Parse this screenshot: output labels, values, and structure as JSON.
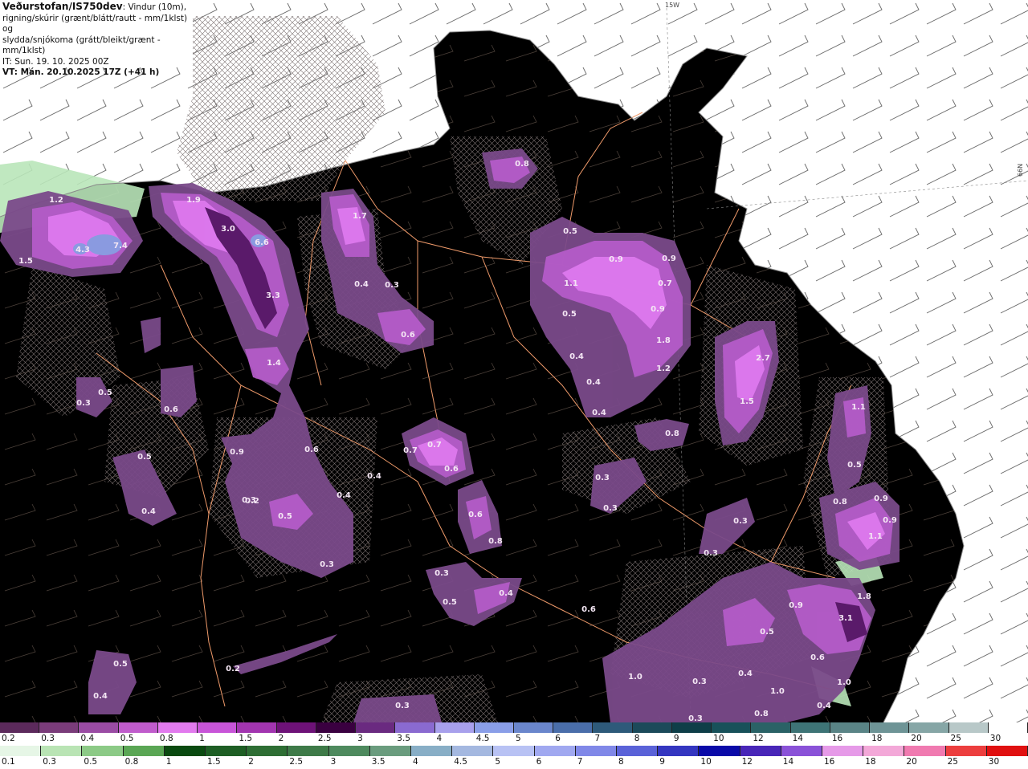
{
  "header": {
    "title_strong": "Veðurstofan/IS750dev",
    "title_rest": ": Vindur (10m),",
    "line2": "rigning/skúrir (grænt/blátt/rautt - mm/1klst) og",
    "line3": "slydda/snjókoma (grátt/bleikt/grænt - mm/1klst)",
    "it_line": "IT: Sun. 19. 10. 2025 00Z",
    "vt_line": "VT: Mán. 20.10.2025 17Z (+41 h)"
  },
  "grid_labels": {
    "lon": "15W",
    "lat": "66N"
  },
  "colors": {
    "sea": "#ffffff",
    "land": "#f1e2d0",
    "roads": "#ef9a6a",
    "coast": "#9a9a9a",
    "precip_light": "#7a4a8a",
    "precip_mid": "#b45cc8",
    "precip_high": "#e07af0",
    "precip_peak": "#5a1a6a",
    "precip_blue": "#8a9ae0",
    "rain_green": "#b9e6b9"
  },
  "map_labels": [
    {
      "text": "1.2"
    },
    {
      "text": "4.3"
    },
    {
      "text": "7.4"
    },
    {
      "text": "1.5"
    },
    {
      "text": "1.9"
    },
    {
      "text": "3.0"
    },
    {
      "text": "6.6"
    },
    {
      "text": "3.3"
    },
    {
      "text": "1.4"
    },
    {
      "text": "1.7"
    },
    {
      "text": "0.4"
    },
    {
      "text": "0.3"
    },
    {
      "text": "0.6"
    },
    {
      "text": "0.8"
    },
    {
      "text": "0.5"
    },
    {
      "text": "0.9"
    },
    {
      "text": "0.9"
    },
    {
      "text": "1.1"
    },
    {
      "text": "0.7"
    },
    {
      "text": "0.5"
    },
    {
      "text": "0.9"
    },
    {
      "text": "1.8"
    },
    {
      "text": "1.2"
    },
    {
      "text": "0.4"
    },
    {
      "text": "0.4"
    },
    {
      "text": "0.4"
    },
    {
      "text": "2.7"
    },
    {
      "text": "1.5"
    },
    {
      "text": "1.1"
    },
    {
      "text": "0.8"
    },
    {
      "text": "0.5"
    },
    {
      "text": "0.8"
    },
    {
      "text": "0.7"
    },
    {
      "text": "0.7"
    },
    {
      "text": "0.6"
    },
    {
      "text": "0.6"
    },
    {
      "text": "0.8"
    },
    {
      "text": "0.9"
    },
    {
      "text": "0.6"
    },
    {
      "text": "0.4"
    },
    {
      "text": "0.6"
    },
    {
      "text": "0.4"
    },
    {
      "text": "0.3"
    },
    {
      "text": "0.3"
    },
    {
      "text": "0.3"
    },
    {
      "text": "0.3"
    },
    {
      "text": "0.5"
    },
    {
      "text": "0.9"
    },
    {
      "text": "0.9"
    },
    {
      "text": "1.1"
    },
    {
      "text": "0.3"
    },
    {
      "text": "0.5"
    },
    {
      "text": "0.4"
    },
    {
      "text": "0.2"
    },
    {
      "text": "0.5"
    },
    {
      "text": "0.4"
    },
    {
      "text": "0.3"
    },
    {
      "text": "0.3"
    },
    {
      "text": "0.4"
    },
    {
      "text": "0.9"
    },
    {
      "text": "0.5"
    },
    {
      "text": "3.1"
    },
    {
      "text": "1.8"
    },
    {
      "text": "0.6"
    },
    {
      "text": "1.0"
    },
    {
      "text": "0.3"
    },
    {
      "text": "0.4"
    },
    {
      "text": "1.0"
    },
    {
      "text": "1.0"
    },
    {
      "text": "0.8"
    },
    {
      "text": "0.3"
    },
    {
      "text": "0.4"
    },
    {
      "text": "0.5"
    },
    {
      "text": "0.3"
    },
    {
      "text": "0.3"
    },
    {
      "text": "0.6"
    },
    {
      "text": "0.2"
    },
    {
      "text": "0.5"
    }
  ],
  "legend_snow": [
    {
      "label": "0.2",
      "color": "#5c2a5c"
    },
    {
      "label": "0.3",
      "color": "#7a3c7a"
    },
    {
      "label": "0.4",
      "color": "#9a4ca4"
    },
    {
      "label": "0.5",
      "color": "#c05ccc"
    },
    {
      "label": "0.8",
      "color": "#e27aee"
    },
    {
      "label": "1",
      "color": "#c855d8"
    },
    {
      "label": "1.5",
      "color": "#a235b0"
    },
    {
      "label": "2",
      "color": "#6e1278"
    },
    {
      "label": "2.5",
      "color": "#3a0040"
    },
    {
      "label": "3",
      "color": "#6a2a80"
    },
    {
      "label": "3.5",
      "color": "#8a6ad0"
    },
    {
      "label": "4",
      "color": "#a8a0ec"
    },
    {
      "label": "4.5",
      "color": "#8a9ee8"
    },
    {
      "label": "5",
      "color": "#6a86cc"
    },
    {
      "label": "6",
      "color": "#4a6eaa"
    },
    {
      "label": "7",
      "color": "#2e5a7a"
    },
    {
      "label": "8",
      "color": "#1c4a5a"
    },
    {
      "label": "9",
      "color": "#0e3e48"
    },
    {
      "label": "10",
      "color": "#18515a"
    },
    {
      "label": "12",
      "color": "#2a6266"
    },
    {
      "label": "14",
      "color": "#3e7476"
    },
    {
      "label": "16",
      "color": "#5a8486"
    },
    {
      "label": "18",
      "color": "#6e9496"
    },
    {
      "label": "20",
      "color": "#86a6a6"
    },
    {
      "label": "25",
      "color": "#b8c8c8"
    },
    {
      "label": "30",
      "color": "#ffffff"
    }
  ],
  "legend_rain": [
    {
      "label": "0.1",
      "color": "#e6f6e6"
    },
    {
      "label": "0.3",
      "color": "#b9e4b4"
    },
    {
      "label": "0.5",
      "color": "#8cca86"
    },
    {
      "label": "0.8",
      "color": "#5aa654"
    },
    {
      "label": "1",
      "color": "#0a4a10"
    },
    {
      "label": "1.5",
      "color": "#1e5e24"
    },
    {
      "label": "2",
      "color": "#2e6e34"
    },
    {
      "label": "2.5",
      "color": "#3e7a48"
    },
    {
      "label": "3",
      "color": "#4e8a5e"
    },
    {
      "label": "3.5",
      "color": "#6a9c7e"
    },
    {
      "label": "4",
      "color": "#88aec6"
    },
    {
      "label": "4.5",
      "color": "#a4b8e0"
    },
    {
      "label": "5",
      "color": "#b8c2f4"
    },
    {
      "label": "6",
      "color": "#a0a8f0"
    },
    {
      "label": "7",
      "color": "#8088e8"
    },
    {
      "label": "8",
      "color": "#5a62d8"
    },
    {
      "label": "9",
      "color": "#3436c0"
    },
    {
      "label": "10",
      "color": "#0a0aa8"
    },
    {
      "label": "12",
      "color": "#4826b8"
    },
    {
      "label": "14",
      "color": "#8a52d8"
    },
    {
      "label": "16",
      "color": "#e69ae8"
    },
    {
      "label": "18",
      "color": "#f3a8d8"
    },
    {
      "label": "20",
      "color": "#f07ab0"
    },
    {
      "label": "25",
      "color": "#ec3e3e"
    },
    {
      "label": "30",
      "color": "#e01010"
    }
  ]
}
